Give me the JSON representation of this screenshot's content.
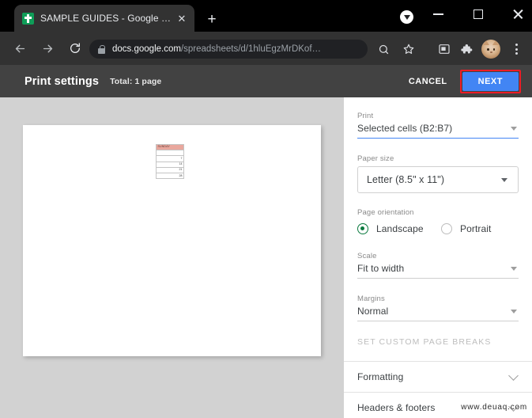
{
  "browser": {
    "tab": {
      "title": "SAMPLE GUIDES - Google Sheets",
      "close_label": "✕",
      "favicon_name": "google-sheets-icon"
    },
    "new_tab_label": "+",
    "window_controls": {
      "minimize": "—",
      "maximize": "□",
      "close": "✕"
    },
    "nav": {
      "back": "back-arrow",
      "forward": "forward-arrow",
      "reload": "reload-icon"
    },
    "omnibox": {
      "host": "docs.google.com",
      "path": "/spreadsheets/d/1hluEgzMrDKof…",
      "lock_icon": "lock-icon"
    },
    "toolbar_icons": {
      "zoom": "search-zoom-icon",
      "bookmark": "star-icon",
      "cast": "cast-icon",
      "extensions": "puzzle-piece-icon",
      "profile": "avatar-cat",
      "menu": "three-dot-menu-icon"
    }
  },
  "print_settings": {
    "title": "Print settings",
    "total": "Total: 1 page",
    "cancel_label": "CANCEL",
    "next_label": "NEXT",
    "next_highlight_color": "#ee1c25",
    "next_button_color": "#4285f4"
  },
  "preview": {
    "background_color": "#d2d2d2",
    "page_color": "#ffffff",
    "table": {
      "header": "SUNDAY",
      "header_color": "#e9a79d",
      "rows": [
        "",
        "7",
        "14",
        "21",
        "28"
      ]
    }
  },
  "sidebar": {
    "print": {
      "label": "Print",
      "value": "Selected cells (B2:B7)",
      "focused": true,
      "accent_color": "#4285f4"
    },
    "paper_size": {
      "label": "Paper size",
      "value": "Letter (8.5\" x 11\")"
    },
    "page_orientation": {
      "label": "Page orientation",
      "options": [
        {
          "label": "Landscape",
          "selected": true
        },
        {
          "label": "Portrait",
          "selected": false
        }
      ],
      "selected_color": "#0b7a3f"
    },
    "scale": {
      "label": "Scale",
      "value": "Fit to width"
    },
    "margins": {
      "label": "Margins",
      "value": "Normal"
    },
    "page_breaks_label": "SET CUSTOM PAGE BREAKS",
    "accordions": [
      {
        "label": "Formatting"
      },
      {
        "label": "Headers & footers"
      }
    ]
  },
  "watermark": "www.deuaq.com"
}
